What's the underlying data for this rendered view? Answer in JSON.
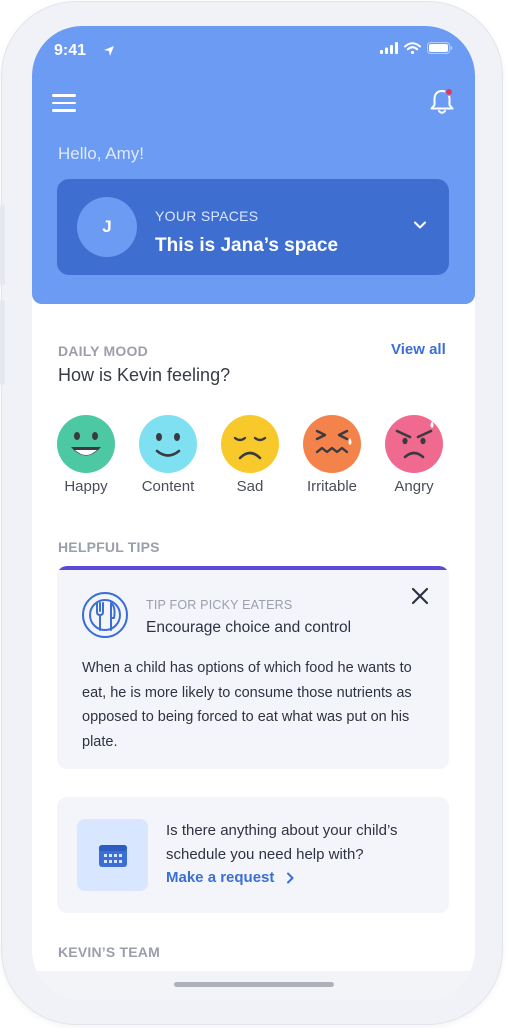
{
  "status_bar": {
    "time": "9:41"
  },
  "header": {
    "greeting": "Hello, Amy!",
    "space_card": {
      "avatar_initial": "J",
      "label": "YOUR SPACES",
      "title": "This is Jana’s space"
    }
  },
  "daily_mood": {
    "label": "DAILY MOOD",
    "view_all": "View all",
    "question": "How is Kevin feeling?",
    "moods": [
      {
        "label": "Happy",
        "color": "#4cc9a3"
      },
      {
        "label": "Content",
        "color": "#7ee0f0"
      },
      {
        "label": "Sad",
        "color": "#f8c92a"
      },
      {
        "label": "Irritable",
        "color": "#f4834b"
      },
      {
        "label": "Angry",
        "color": "#f0698f"
      }
    ]
  },
  "helpful_tips": {
    "label": "HELPFUL TIPS",
    "tip": {
      "kicker": "TIP FOR PICKY EATERS",
      "title": "Encourage choice and control",
      "body": "When a child has options of which food he wants to eat, he is more likely to consume those nutrients as opposed to being forced to eat what was put on his plate."
    }
  },
  "request_card": {
    "text": "Is there anything about your child’s schedule you need help with?",
    "link": "Make a request"
  },
  "team": {
    "label": "KEVIN’S TEAM"
  },
  "colors": {
    "header_blue": "#6c9bf3",
    "card_blue": "#3f6ed1",
    "link_blue": "#3b6fd6",
    "tip_accent": "#5b4ad9"
  }
}
